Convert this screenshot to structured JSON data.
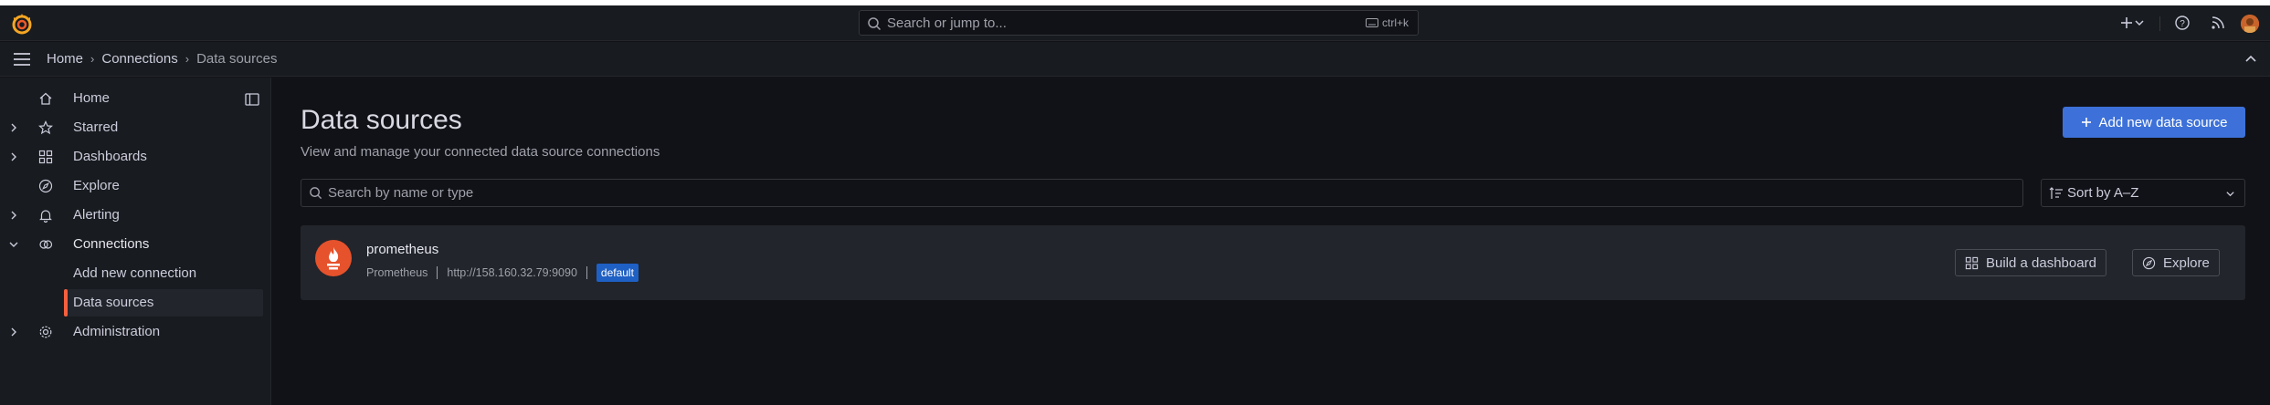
{
  "topbar": {
    "search_placeholder": "Search or jump to...",
    "search_shortcut": "ctrl+k"
  },
  "breadcrumb": {
    "items": [
      "Home",
      "Connections",
      "Data sources"
    ]
  },
  "sidebar": {
    "items": [
      {
        "label": "Home",
        "icon": "home-icon"
      },
      {
        "label": "Starred",
        "icon": "star-icon"
      },
      {
        "label": "Dashboards",
        "icon": "apps-icon"
      },
      {
        "label": "Explore",
        "icon": "compass-icon"
      },
      {
        "label": "Alerting",
        "icon": "bell-icon"
      },
      {
        "label": "Connections",
        "icon": "connections-icon"
      },
      {
        "label": "Administration",
        "icon": "gear-icon"
      }
    ],
    "sub_items": [
      {
        "label": "Add new connection"
      },
      {
        "label": "Data sources"
      }
    ]
  },
  "main": {
    "title": "Data sources",
    "subtitle": "View and manage your connected data source connections",
    "add_button": "Add new data source",
    "filter_placeholder": "Search by name or type",
    "sort_value": "Sort by A–Z"
  },
  "datasource": {
    "name": "prometheus",
    "type": "Prometheus",
    "url": "http://158.160.32.79:9090",
    "badge": "default",
    "build_button": "Build a dashboard",
    "explore_button": "Explore"
  },
  "colors": {
    "accent_blue": "#3d71d9",
    "active_orange": "#f55f3e",
    "badge_blue": "#1f60c4"
  }
}
